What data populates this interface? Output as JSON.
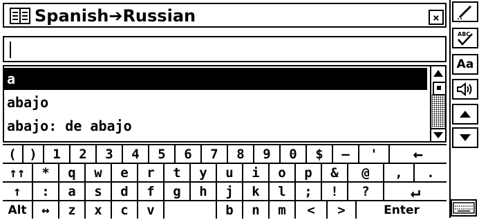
{
  "window": {
    "title": "Spanish➔Russian",
    "close_label": "×"
  },
  "search": {
    "value": ""
  },
  "results": [
    {
      "text": "a",
      "selected": true
    },
    {
      "text": "abajo",
      "selected": false
    },
    {
      "text": "abajo: de abajo",
      "selected": false
    }
  ],
  "sidebar": {
    "font_button": "Aa"
  },
  "keyboard": {
    "row1": [
      "(",
      ")",
      "1",
      "2",
      "3",
      "4",
      "5",
      "6",
      "7",
      "8",
      "9",
      "0",
      "$",
      "–",
      "'",
      "←"
    ],
    "row2": [
      "↑↑",
      "*",
      "q",
      "w",
      "e",
      "r",
      "t",
      "y",
      "u",
      "i",
      "o",
      "p",
      "&",
      "@",
      ",",
      "."
    ],
    "row3": [
      "↑",
      ":",
      "a",
      "s",
      "d",
      "f",
      "g",
      "h",
      "j",
      "k",
      "l",
      ";",
      "!",
      "?",
      "↵"
    ],
    "row4": [
      "Alt",
      "↔",
      "z",
      "x",
      "c",
      "v",
      "",
      "b",
      "n",
      "m",
      "<",
      ">",
      "Enter"
    ]
  }
}
